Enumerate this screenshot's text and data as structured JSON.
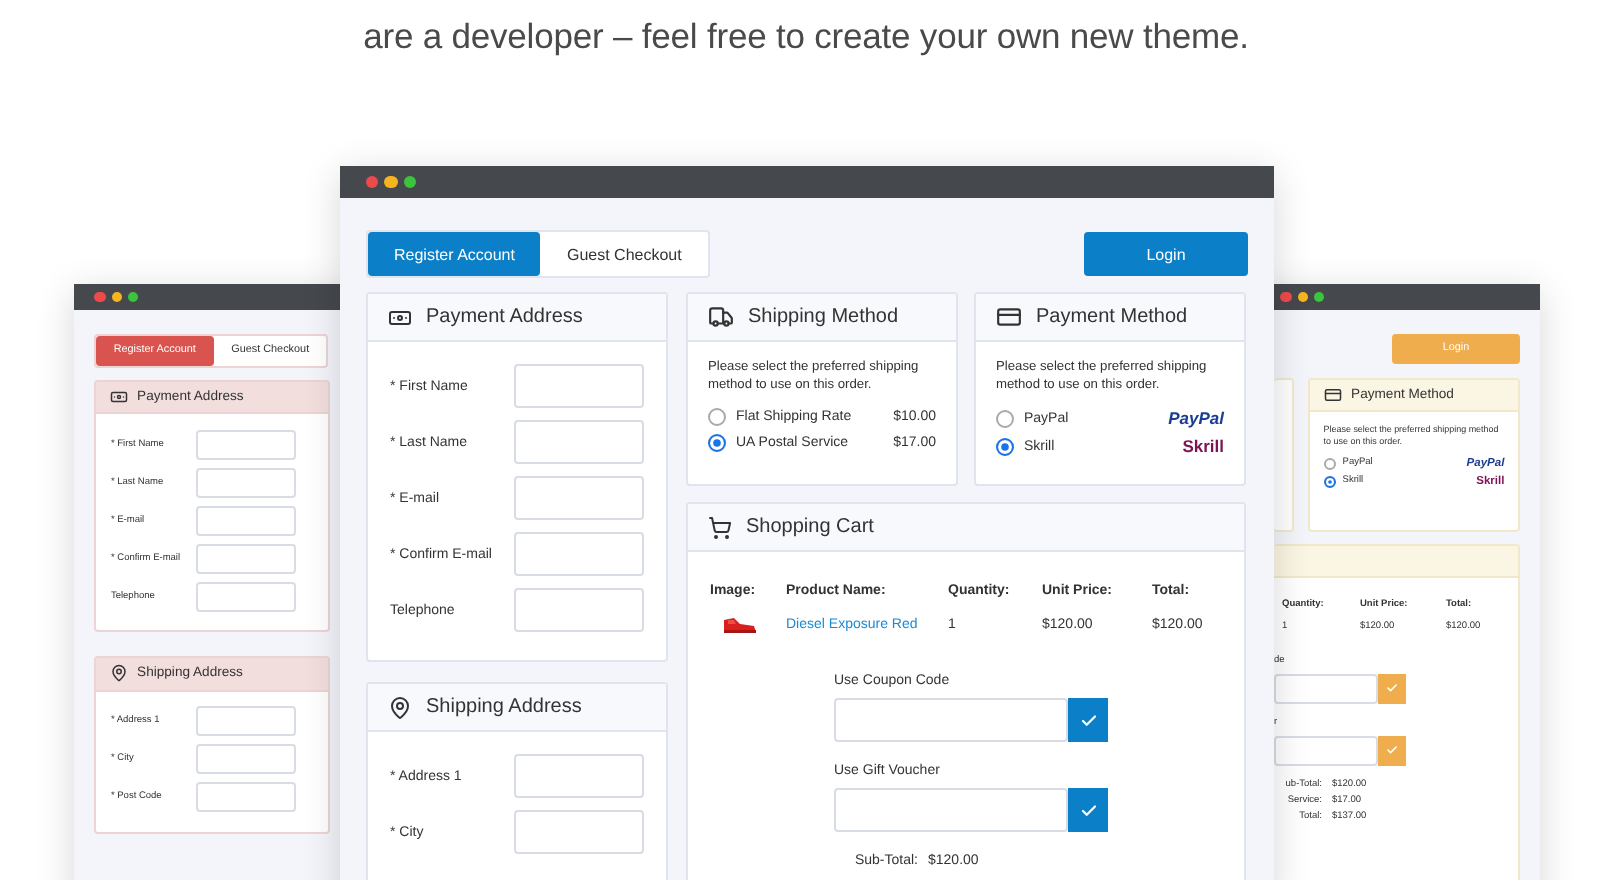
{
  "headline": "are a developer – feel free to create your own new theme.",
  "left_window": {
    "tabs": [
      {
        "label": "Register Account",
        "selected": true
      },
      {
        "label": "Guest Checkout",
        "selected": false
      }
    ],
    "payment_address": {
      "title": "Payment Address",
      "fields": [
        "* First Name",
        "* Last Name",
        "* E-mail",
        "* Confirm E-mail",
        "Telephone"
      ]
    },
    "shipping_address": {
      "title": "Shipping Address",
      "fields": [
        "* Address 1",
        "* City",
        "* Post Code"
      ]
    }
  },
  "front_window": {
    "tabs": [
      {
        "label": "Register Account",
        "selected": true
      },
      {
        "label": "Guest Checkout",
        "selected": false
      }
    ],
    "login_button": "Login",
    "payment_address": {
      "title": "Payment Address",
      "fields": [
        "* First Name",
        "* Last Name",
        "* E-mail",
        "* Confirm E-mail",
        "Telephone"
      ]
    },
    "shipping_address": {
      "title": "Shipping Address",
      "fields": [
        "* Address 1",
        "* City"
      ]
    },
    "shipping_method": {
      "title": "Shipping Method",
      "description": "Please select the preferred shipping method to use on this order.",
      "options": [
        {
          "label": "Flat Shipping Rate",
          "price": "$10.00",
          "selected": false
        },
        {
          "label": "UA Postal Service",
          "price": "$17.00",
          "selected": true
        }
      ]
    },
    "payment_method": {
      "title": "Payment Method",
      "description": "Please select the preferred shipping method to use on this order.",
      "options": [
        {
          "label": "PayPal",
          "logo": "PayPal",
          "selected": false
        },
        {
          "label": "Skrill",
          "logo": "Skrill",
          "selected": true
        }
      ]
    },
    "cart": {
      "title": "Shopping Cart",
      "columns": [
        "Image:",
        "Product Name:",
        "Quantity:",
        "Unit Price:",
        "Total:"
      ],
      "rows": [
        {
          "product": "Diesel Exposure Red",
          "quantity": "1",
          "unit_price": "$120.00",
          "total": "$120.00"
        }
      ],
      "coupon_label": "Use Coupon Code",
      "voucher_label": "Use Gift Voucher",
      "totals": [
        {
          "label": "Sub-Total:",
          "value": "$120.00"
        }
      ]
    }
  },
  "right_window": {
    "login_button": "Login",
    "payment_method": {
      "title": "Payment Method",
      "description": "Please select the preferred shipping method to use on this order.",
      "options": [
        {
          "label": "PayPal",
          "logo": "PayPal",
          "selected": false
        },
        {
          "label": "Skrill",
          "logo": "Skrill",
          "selected": true
        }
      ]
    },
    "cart": {
      "columns": [
        "Quantity:",
        "Unit Price:",
        "Total:"
      ],
      "rows": [
        {
          "quantity": "1",
          "unit_price": "$120.00",
          "total": "$120.00"
        }
      ],
      "coupon_label": "de",
      "voucher_label": "r",
      "totals": [
        {
          "label": "ub-Total:",
          "value": "$120.00"
        },
        {
          "label": "Service:",
          "value": "$17.00"
        },
        {
          "label": "Total:",
          "value": "$137.00"
        }
      ]
    }
  }
}
